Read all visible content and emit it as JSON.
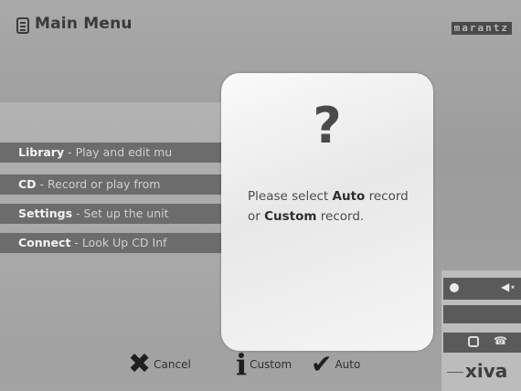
{
  "header": {
    "title": "Main Menu",
    "brand": "marantz"
  },
  "menu": {
    "items": [
      {
        "name": "Library",
        "desc": " - Play and edit mu"
      },
      {
        "name": "CD",
        "desc": " - Record or play from"
      },
      {
        "name": "Settings",
        "desc": " - Set up the unit"
      },
      {
        "name": "Connect",
        "desc": " - Look Up CD Inf"
      }
    ]
  },
  "dialog": {
    "symbol": "?",
    "text_1": "Please select ",
    "text_auto": "Auto",
    "text_2": " record or ",
    "text_custom": "Custom",
    "text_3": " record."
  },
  "buttons": {
    "cancel": "Cancel",
    "custom": "Custom",
    "auto": "Auto"
  },
  "side": {
    "logo": "xiva"
  },
  "icons": {
    "menu_icon": "document-icon",
    "cancel": "x-icon",
    "custom": "info-icon",
    "auto": "checkmark-icon"
  }
}
